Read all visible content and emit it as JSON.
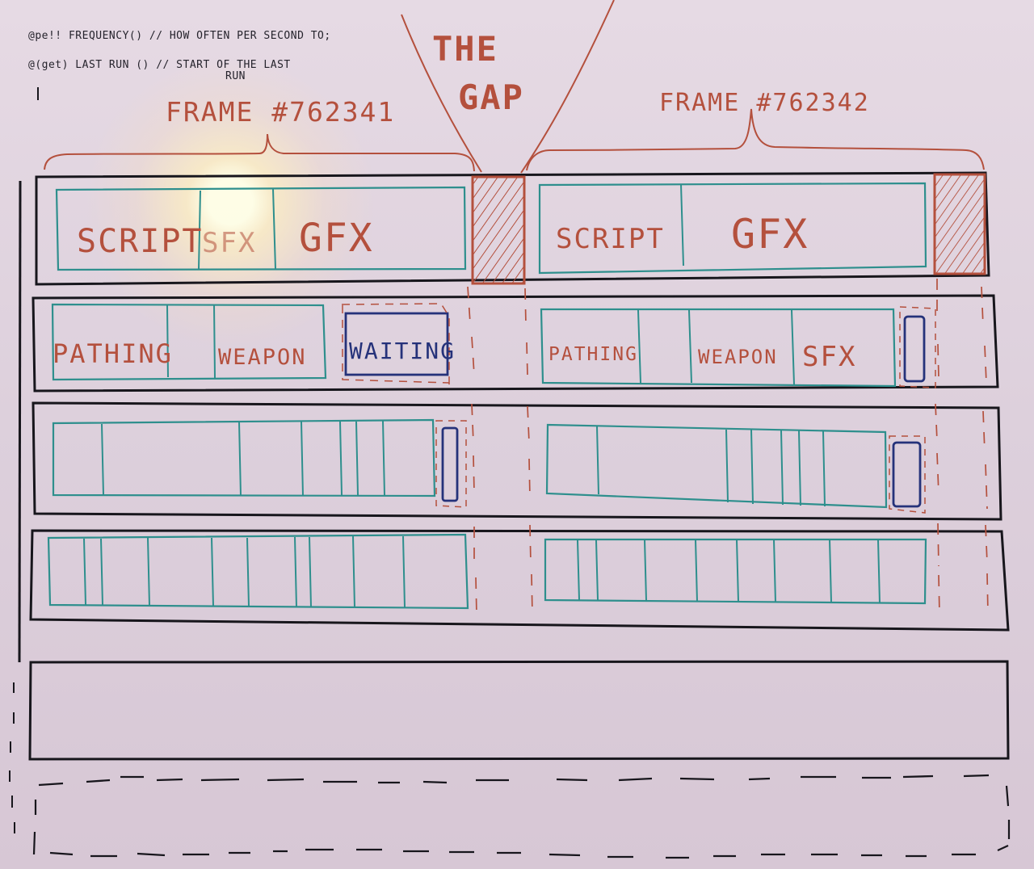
{
  "notes": {
    "line1": "@pe!! FREQUENCY() // HOW OFTEN PER SECOND TO;",
    "line2": "@(get) LAST RUN ()   // START OF THE LAST",
    "line2_cont": "RUN"
  },
  "gap": {
    "line1": "THE",
    "line2": "GAP"
  },
  "frames": {
    "left": "FRAME #762341",
    "right": "FRAME #762342"
  },
  "row1": {
    "left_labels": [
      "SCRIPT",
      "SFX",
      "GFX"
    ],
    "right_labels": [
      "SCRIPT",
      "GFX"
    ]
  },
  "row2": {
    "left_labels": [
      "PATHING",
      "WEAPON",
      "WAITING"
    ],
    "right_labels": [
      "PATHING",
      "WEAPON",
      "SFX"
    ]
  },
  "colors": {
    "board": "#d8c7d6",
    "red": "#b4503d",
    "black": "#17161c",
    "teal": "#2e8f8d",
    "navy": "#25327a"
  }
}
